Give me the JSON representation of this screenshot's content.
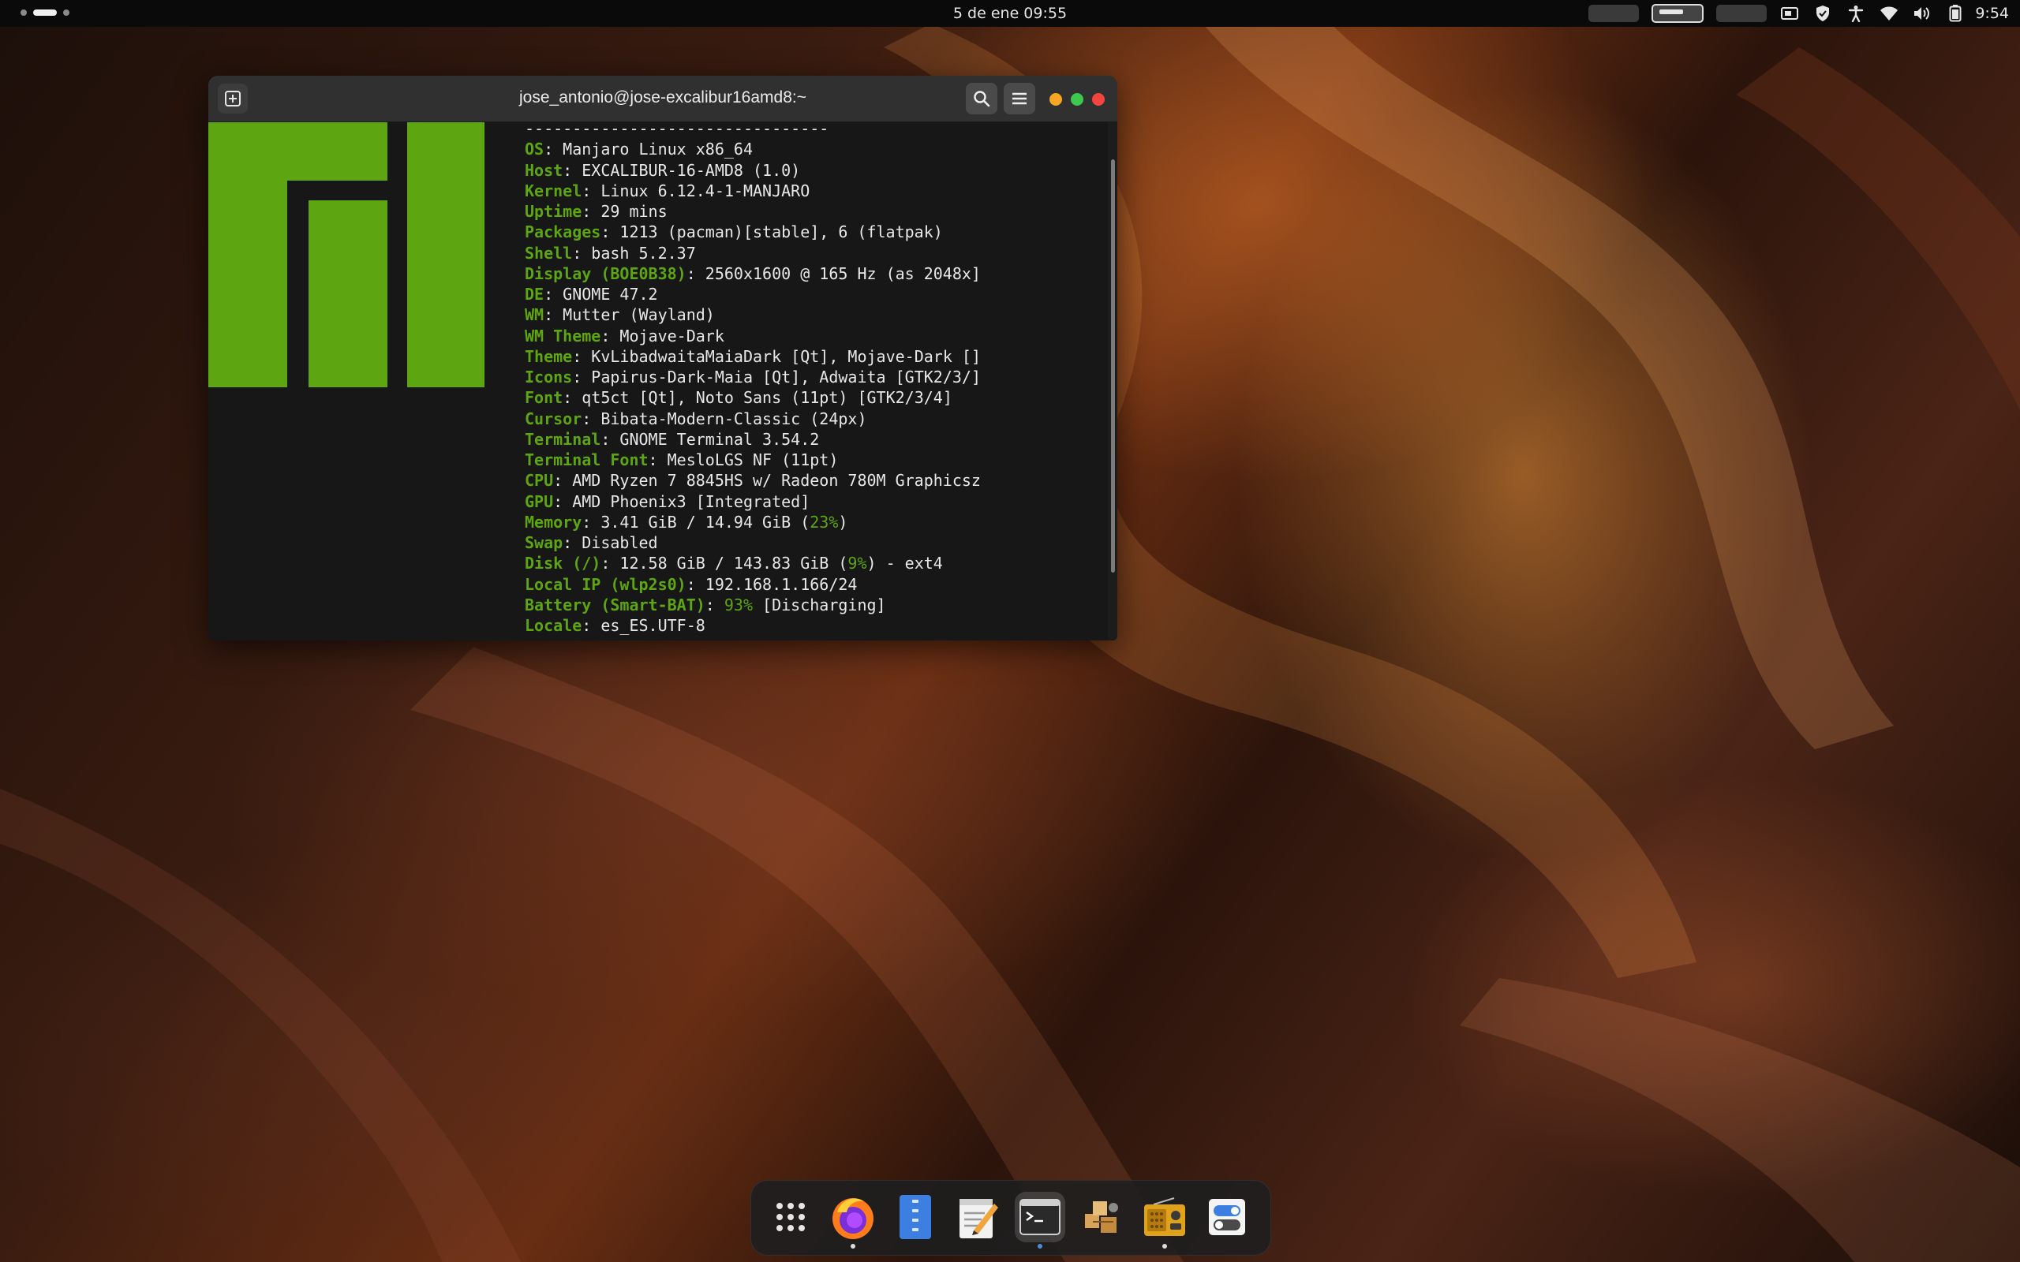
{
  "topbar": {
    "clock": "5 de ene  09:55",
    "time": "9:54",
    "tray_icons": [
      "screen-share-icon",
      "vpn-shield-icon",
      "accessibility-icon",
      "wifi-icon",
      "volume-icon",
      "battery-icon"
    ]
  },
  "terminal": {
    "title": "jose_antonio@jose-excalibur16amd8:~",
    "separator": "--------------------------------",
    "lines": [
      {
        "key": "OS",
        "value": ": Manjaro Linux x86_64"
      },
      {
        "key": "Host",
        "value": ": EXCALIBUR-16-AMD8 (1.0)"
      },
      {
        "key": "Kernel",
        "value": ": Linux 6.12.4-1-MANJARO"
      },
      {
        "key": "Uptime",
        "value": ": 29 mins"
      },
      {
        "key": "Packages",
        "value": ": 1213 (pacman)[stable], 6 (flatpak)"
      },
      {
        "key": "Shell",
        "value": ": bash 5.2.37"
      },
      {
        "key": "Display (BOE0B38)",
        "value": ": 2560x1600 @ 165 Hz (as 2048x]"
      },
      {
        "key": "DE",
        "value": ": GNOME 47.2"
      },
      {
        "key": "WM",
        "value": ": Mutter (Wayland)"
      },
      {
        "key": "WM Theme",
        "value": ": Mojave-Dark"
      },
      {
        "key": "Theme",
        "value": ": KvLibadwaitaMaiaDark [Qt], Mojave-Dark []"
      },
      {
        "key": "Icons",
        "value": ": Papirus-Dark-Maia [Qt], Adwaita [GTK2/3/]"
      },
      {
        "key": "Font",
        "value": ": qt5ct [Qt], Noto Sans (11pt) [GTK2/3/4]"
      },
      {
        "key": "Cursor",
        "value": ": Bibata-Modern-Classic (24px)"
      },
      {
        "key": "Terminal",
        "value": ": GNOME Terminal 3.54.2"
      },
      {
        "key": "Terminal Font",
        "value": ": MesloLGS NF (11pt)"
      },
      {
        "key": "CPU",
        "value": ": AMD Ryzen 7 8845HS w/ Radeon 780M Graphicsz"
      },
      {
        "key": "GPU",
        "value": ": AMD Phoenix3 [Integrated]"
      }
    ],
    "memory": {
      "key": "Memory",
      "pre": ": 3.41 GiB / 14.94 GiB (",
      "pct": "23%",
      "post": ")"
    },
    "swap": {
      "key": "Swap",
      "value": ": Disabled"
    },
    "disk": {
      "key": "Disk (/)",
      "pre": ": 12.58 GiB / 143.83 GiB (",
      "pct": "9%",
      "post": ") - ext4"
    },
    "localip": {
      "key": "Local IP (wlp2s0)",
      "value": ": 192.168.1.166/24"
    },
    "battery": {
      "key": "Battery (Smart-BAT)",
      "pre": ": ",
      "pct": "93%",
      "post": " [Discharging]"
    },
    "locale": {
      "key": "Locale",
      "value": ": es_ES.UTF-8"
    }
  },
  "dock": {
    "items": [
      {
        "name": "app-grid-icon"
      },
      {
        "name": "firefox-icon"
      },
      {
        "name": "files-icon"
      },
      {
        "name": "text-editor-icon"
      },
      {
        "name": "terminal-icon"
      },
      {
        "name": "package-manager-icon"
      },
      {
        "name": "radio-icon"
      },
      {
        "name": "settings-toggle-icon"
      }
    ]
  },
  "colors": {
    "accent_green": "#5ea512",
    "titlebar": "#303030",
    "terminal_bg": "#171717"
  }
}
